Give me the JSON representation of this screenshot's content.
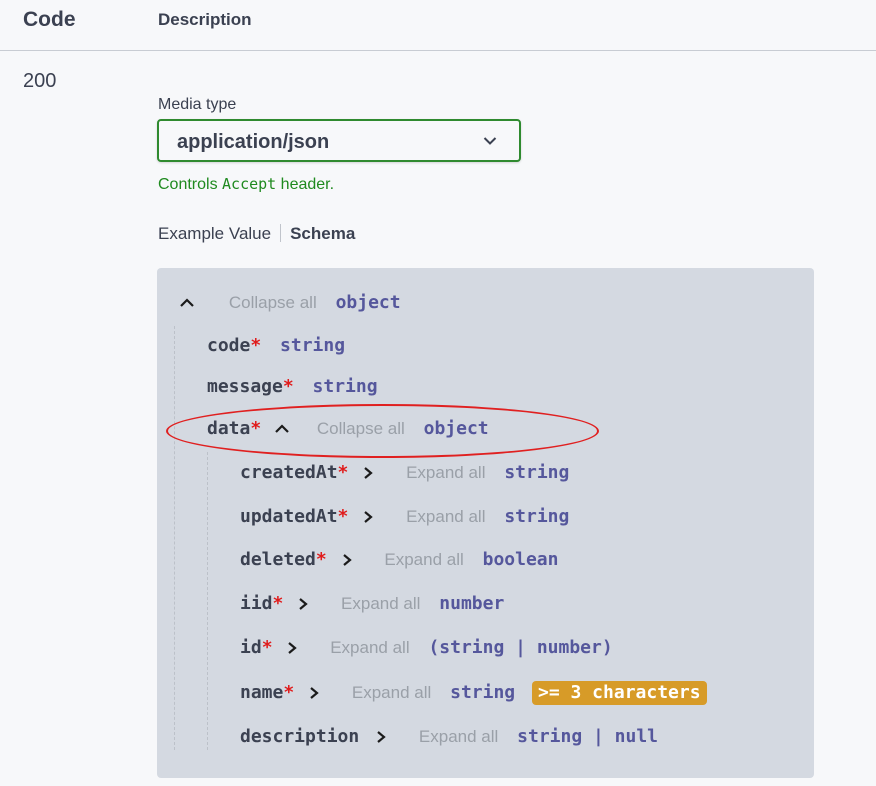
{
  "table": {
    "code_header": "Code",
    "description_header": "Description",
    "response_code": "200"
  },
  "media": {
    "label": "Media type",
    "selected": "application/json",
    "controls_pre": "Controls ",
    "controls_code": "Accept",
    "controls_post": " header."
  },
  "tabs": {
    "example": "Example Value",
    "schema": "Schema"
  },
  "schema": {
    "root": {
      "toggle": "Collapse all",
      "type": "object"
    },
    "code": {
      "name": "code",
      "star": "*",
      "type": "string"
    },
    "message": {
      "name": "message",
      "star": "*",
      "type": "string"
    },
    "data": {
      "name": "data",
      "star": "*",
      "toggle": "Collapse all",
      "type": "object"
    },
    "createdAt": {
      "name": "createdAt",
      "star": "*",
      "toggle": "Expand all",
      "type": "string"
    },
    "updatedAt": {
      "name": "updatedAt",
      "star": "*",
      "toggle": "Expand all",
      "type": "string"
    },
    "deleted": {
      "name": "deleted",
      "star": "*",
      "toggle": "Expand all",
      "type": "boolean"
    },
    "iid": {
      "name": "iid",
      "star": "*",
      "toggle": "Expand all",
      "type": "number"
    },
    "id": {
      "name": "id",
      "star": "*",
      "toggle": "Expand all",
      "type": "(string | number)"
    },
    "name": {
      "name": "name",
      "star": "*",
      "toggle": "Expand all",
      "type": "string",
      "badge": ">= 3 characters"
    },
    "description": {
      "name": "description",
      "toggle": "Expand all",
      "type": "string | null"
    }
  },
  "colors": {
    "accent_green": "#2f8a2f",
    "required_red": "#e01b1b",
    "type_purple": "#55579c",
    "badge_orange": "#d79b28",
    "highlight_oval": "#e02020"
  }
}
